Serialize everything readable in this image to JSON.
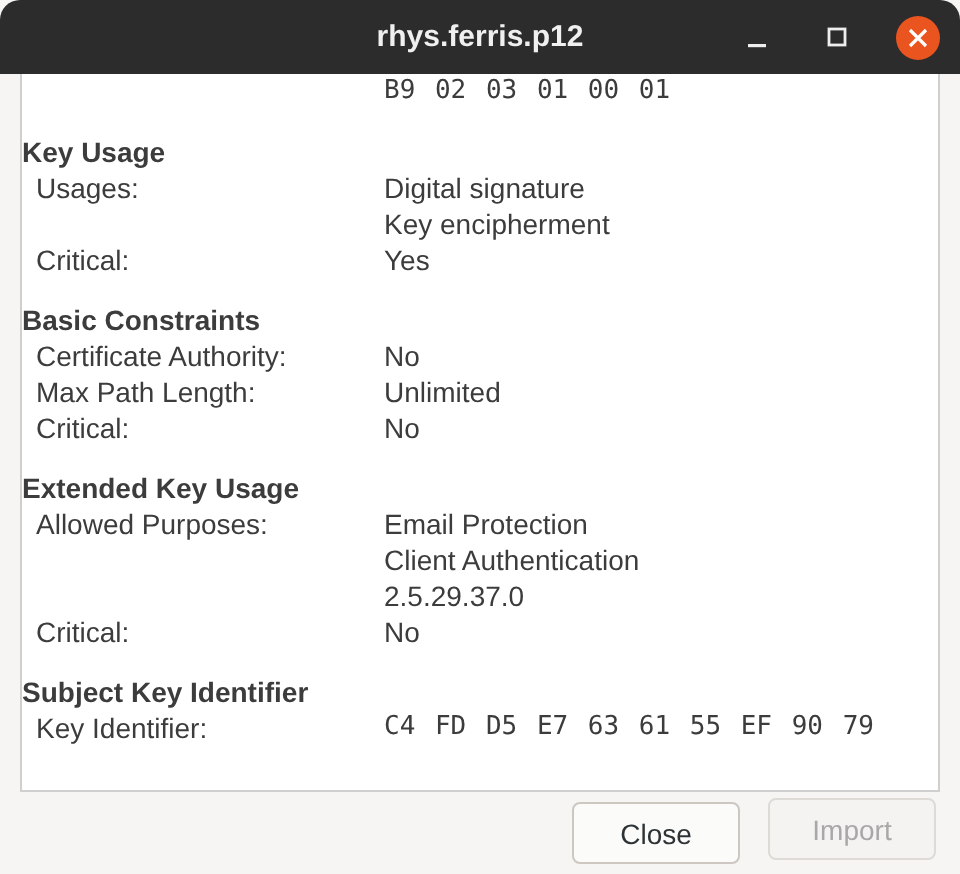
{
  "window": {
    "title": "rhys.ferris.p12"
  },
  "top_value": {
    "kind": "hex",
    "lines": [
      "B9 02 03 01 00 01"
    ]
  },
  "sections": [
    {
      "heading": "Key Usage",
      "fields": [
        {
          "label": "Usages:",
          "kind": "text",
          "values": [
            "Digital signature",
            "Key encipherment"
          ]
        },
        {
          "label": "Critical:",
          "kind": "text",
          "values": [
            "Yes"
          ]
        }
      ]
    },
    {
      "heading": "Basic Constraints",
      "fields": [
        {
          "label": "Certificate Authority:",
          "kind": "text",
          "values": [
            "No"
          ]
        },
        {
          "label": "Max Path Length:",
          "kind": "text",
          "values": [
            "Unlimited"
          ]
        },
        {
          "label": "Critical:",
          "kind": "text",
          "values": [
            "No"
          ]
        }
      ]
    },
    {
      "heading": "Extended Key Usage",
      "fields": [
        {
          "label": "Allowed Purposes:",
          "kind": "text",
          "values": [
            "Email Protection",
            "Client Authentication",
            "2.5.29.37.0"
          ]
        },
        {
          "label": "Critical:",
          "kind": "text",
          "values": [
            "No"
          ]
        }
      ]
    },
    {
      "heading": "Subject Key Identifier",
      "fields": [
        {
          "label": "Key Identifier:",
          "kind": "hex",
          "values": [
            "C4 FD D5 E7 63 61 55 EF 90 79"
          ]
        }
      ]
    }
  ],
  "buttons": [
    {
      "label": "Close",
      "disabled": false
    },
    {
      "label": "Import",
      "disabled": true
    }
  ]
}
